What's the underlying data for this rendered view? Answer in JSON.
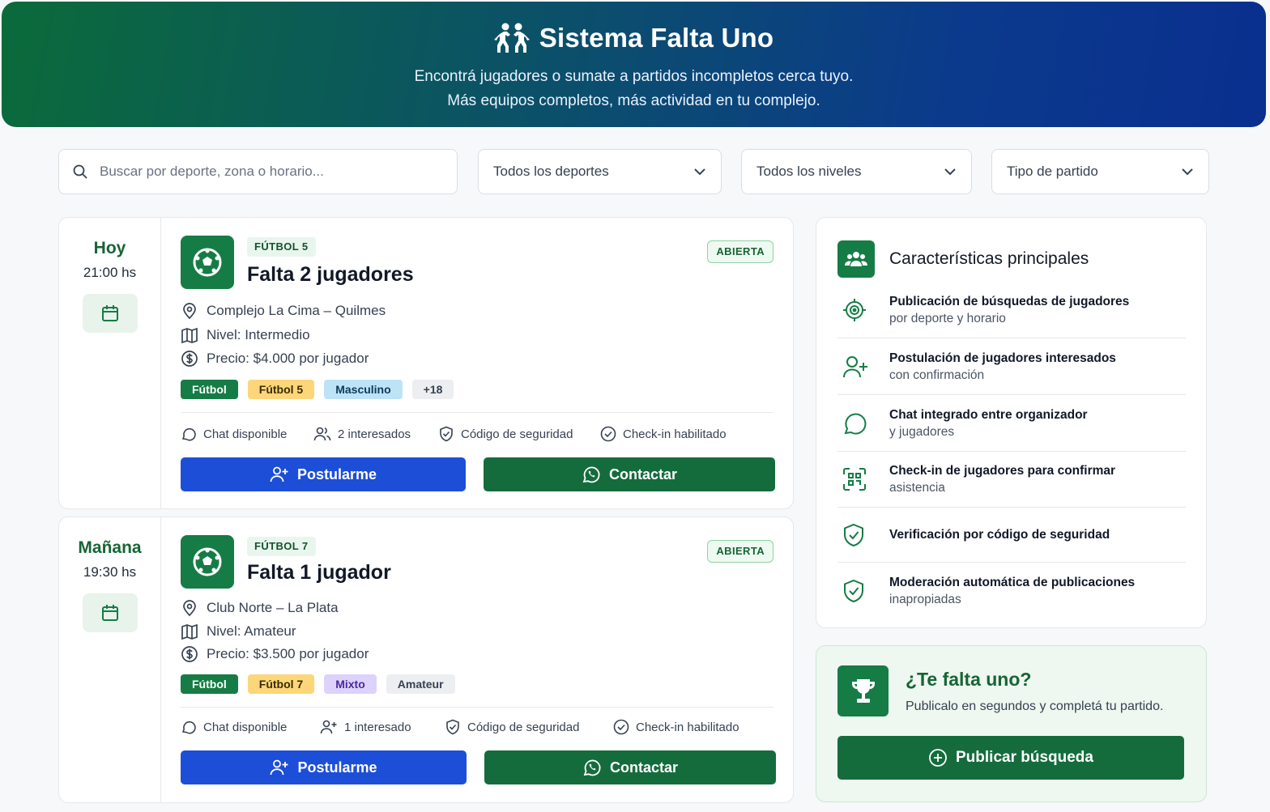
{
  "header": {
    "title": "Sistema Falta Uno",
    "subtitle_line1": "Encontrá jugadores o sumate a partidos incompletos cerca tuyo.",
    "subtitle_line2": "Más equipos completos, más actividad en tu complejo."
  },
  "filters": {
    "search_placeholder": "Buscar por deporte, zona o horario...",
    "sport": "Todos los deportes",
    "level": "Todos los niveles",
    "match_type": "Tipo de partido"
  },
  "matches": [
    {
      "day": "Hoy",
      "time": "21:00 hs",
      "type": "FÚTBOL 5",
      "status": "ABIERTA",
      "title": "Falta 2 jugadores",
      "location": "Complejo La Cima – Quilmes",
      "level": "Nivel: Intermedio",
      "price": "Precio: $4.000 por jugador",
      "tags": [
        "Fútbol",
        "Fútbol 5",
        "Masculino",
        "+18"
      ],
      "chat": "Chat disponible",
      "interested": "2 interesados",
      "security": "Código de seguridad",
      "checkin": "Check-in habilitado",
      "apply_label": "Postularme",
      "contact_label": "Contactar"
    },
    {
      "day": "Mañana",
      "time": "19:30 hs",
      "type": "FÚTBOL 7",
      "status": "ABIERTA",
      "title": "Falta 1 jugador",
      "location": "Club Norte – La Plata",
      "level": "Nivel: Amateur",
      "price": "Precio: $3.500 por jugador",
      "tags": [
        "Fútbol",
        "Fútbol 7",
        "Mixto",
        "Amateur"
      ],
      "chat": "Chat disponible",
      "interested": "1 interesado",
      "security": "Código de seguridad",
      "checkin": "Check-in habilitado",
      "apply_label": "Postularme",
      "contact_label": "Contactar"
    }
  ],
  "features": {
    "title": "Características principales",
    "items": [
      {
        "main": "Publicación de búsquedas de jugadores",
        "sub": "por deporte y horario"
      },
      {
        "main": "Postulación de jugadores interesados",
        "sub": "con confirmación"
      },
      {
        "main": "Chat integrado entre organizador",
        "sub": "y jugadores"
      },
      {
        "main": "Check-in de jugadores para confirmar",
        "sub": "asistencia"
      },
      {
        "main": "Verificación por código de seguridad",
        "sub": ""
      },
      {
        "main": "Moderación automática de publicaciones",
        "sub": "inapropiadas"
      }
    ]
  },
  "cta": {
    "title": "¿Te falta uno?",
    "subtitle": "Publicalo en segundos y completá tu partido.",
    "button": "Publicar búsqueda"
  },
  "colors": {
    "brand_green": "#157c45",
    "brand_blue": "#1d4ed8",
    "tag_green": "#157c45",
    "tag_yellow": "#fcd679",
    "tag_blue": "#bde3f7",
    "tag_purple": "#ddd2fb",
    "tag_gray": "#eceef1"
  }
}
